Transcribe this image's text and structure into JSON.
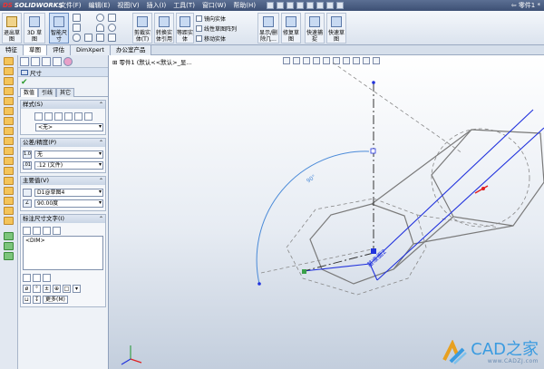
{
  "app": {
    "logo": "SOLIDWORKS",
    "document_title": "零件1 *"
  },
  "menu": [
    "文件(F)",
    "编辑(E)",
    "视图(V)",
    "插入(I)",
    "工具(T)",
    "窗口(W)",
    "帮助(H)"
  ],
  "ribbon": {
    "big_buttons": [
      {
        "label_line1": "退出草",
        "label_line2": "图"
      },
      {
        "label_line1": "3D 草图",
        "label_line2": ""
      },
      {
        "label_line1": "智能尺",
        "label_line2": "寸"
      },
      {
        "label_line1": "剪裁实",
        "label_line2": "体(T)"
      },
      {
        "label_line1": "转换实",
        "label_line2": "体引用"
      },
      {
        "label_line1": "等距实",
        "label_line2": "体"
      },
      {
        "label_line1": "显示/删",
        "label_line2": "除几..."
      },
      {
        "label_line1": "修复草",
        "label_line2": "图"
      },
      {
        "label_line1": "快速捕",
        "label_line2": "捉"
      },
      {
        "label_line1": "快速草",
        "label_line2": "图"
      }
    ],
    "small_commands": [
      "镜向实体",
      "线性草图阵列",
      "移动实体"
    ]
  },
  "tabs": [
    "特征",
    "草图",
    "评估",
    "DimXpert",
    "办公室产品"
  ],
  "tabs_active": 1,
  "property_manager": {
    "title": "尺寸",
    "subtabs": [
      "数值",
      "引线",
      "其它"
    ],
    "style_group": {
      "header": "样式(S)",
      "style_value": "<无>"
    },
    "tolerance_group": {
      "header": "公差/精度(P)",
      "tolerance_value": "无",
      "precision_value": ".12 (文件)"
    },
    "primary_value_group": {
      "header": "主要值(V)",
      "dimension_name": "D1@草图4",
      "dimension_value": "90.00度"
    },
    "dim_text_group": {
      "header": "标注尺寸文字(I)",
      "text_value": "<DIM>",
      "more_button": "更多(M)"
    }
  },
  "graphics": {
    "tree_path": "零件1 (默认<<默认>_显...",
    "plane_label": "基准面2",
    "angle_label": "90°"
  },
  "watermark": {
    "text": "CAD之家",
    "url": "www.CADZJ.com"
  },
  "colors": {
    "sketch_blue": "#2233dd",
    "sketch_gray": "#7a7a7a",
    "dim_blue": "#4a8ad8",
    "select_red": "#e02020"
  }
}
